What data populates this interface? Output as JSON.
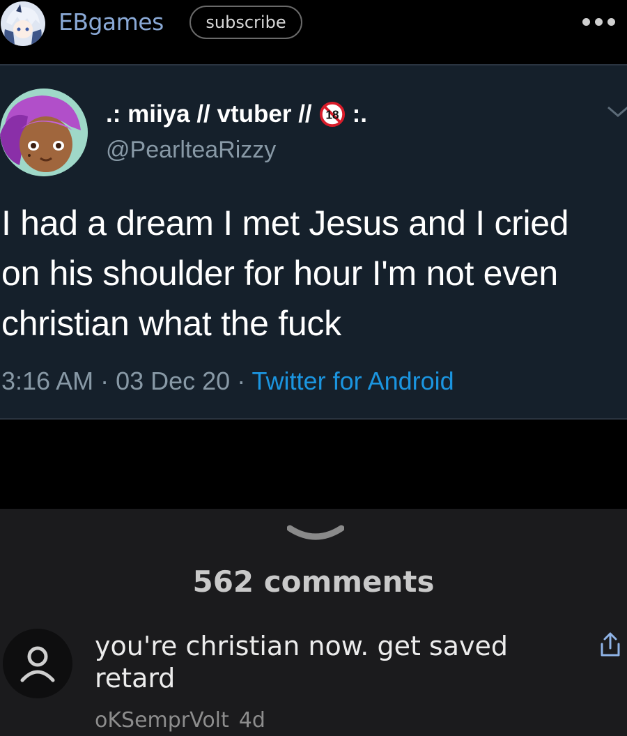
{
  "header": {
    "blog_name": "EBgames",
    "subscribe_label": "subscribe",
    "more_icon": "more-horizontal-icon",
    "avatar_icon": "blog-avatar"
  },
  "tweet": {
    "display_name_prefix": ".: miiya // vtuber //",
    "display_name_suffix": ":.",
    "badge": "18",
    "handle": "@PearlteaRizzy",
    "text": "I had a dream I met Jesus and I cried on his shoulder for hour I'm not even christian what the fuck",
    "time": "3:16 AM",
    "date": "03 Dec 20",
    "source": "Twitter for Android",
    "separator": " · ",
    "colors": {
      "background": "#15202b",
      "source": "#1b95e0",
      "secondary": "#8899a6"
    }
  },
  "comments": {
    "count_label": "562 comments",
    "items": [
      {
        "text": "you're christian now. get saved retard",
        "username": "oKSemprVolt",
        "age": "4d"
      }
    ]
  }
}
